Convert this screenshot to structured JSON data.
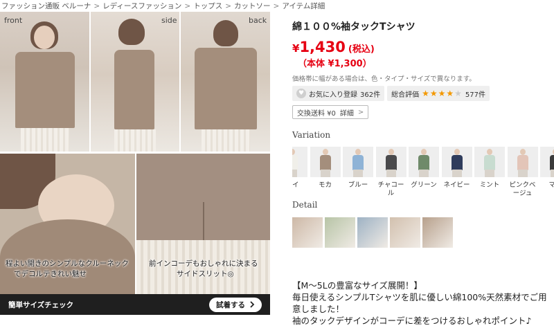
{
  "breadcrumb": [
    "ファッション通販 ベルーナ",
    "レディースファッション",
    "トップス",
    "カットソー",
    "アイテム詳細"
  ],
  "breadcrumb_sep": ">",
  "photos": {
    "labels": [
      "front",
      "side",
      "back"
    ],
    "caption_neck_1": "程よい開きのシンプルなクルーネック",
    "caption_neck_2": "でデコルテきれい魅せ",
    "caption_slit_1": "前インコーデもおしゃれに決まる",
    "caption_slit_2": "サイドスリット◎",
    "size_check": {
      "title": "簡単サイズチェック",
      "button": "試着する",
      "button_icon": "chevron-right-icon"
    }
  },
  "product": {
    "title": "綿１００%袖タックTシャツ",
    "price_yen": "¥",
    "price": "1,430",
    "price_tax": "(税込)",
    "price_base": "（本体 ¥1,300）",
    "price_note": "価格帯に幅がある場合は、色・タイプ・サイズで異なります。",
    "favorite_label": "お気に入り登録",
    "favorite_count": "362件",
    "rating_label": "総合評価",
    "rating": 4,
    "rating_max": 5,
    "review_count": "577件",
    "shipping_label": "交換送料 ¥0",
    "shipping_detail": "詳細",
    "shipping_chevron": ">"
  },
  "variation": {
    "label": "Variation",
    "items": [
      {
        "name": "ワイ",
        "color": "#f0efe9"
      },
      {
        "name": "モカ",
        "color": "#a48e7c"
      },
      {
        "name": "ブルー",
        "color": "#8fb3d6"
      },
      {
        "name": "チャコール",
        "color": "#4a4a4c"
      },
      {
        "name": "グリーン",
        "color": "#6f8a6a"
      },
      {
        "name": "ネイビー",
        "color": "#2f3c5c"
      },
      {
        "name": "ミント",
        "color": "#c8dcd0"
      },
      {
        "name": "ピンクベージュ",
        "color": "#e3c5b8"
      },
      {
        "name": "マス",
        "color": "#3a3a3a"
      }
    ]
  },
  "detail": {
    "label": "Detail",
    "thumbs": [
      "#cdb8a6",
      "#b7c4a6",
      "#9eb2c4",
      "#d2c0ae",
      "#b7a08c"
    ]
  },
  "description": {
    "line1": "【M～5Lの豊富なサイズ展開！】",
    "line2": "毎日使えるシンプルTシャツを肌に優しい綿100%天然素材でご用意しました！",
    "line3": "袖のタックデザインがコーデに差をつけるおしゃれポイント♪"
  }
}
